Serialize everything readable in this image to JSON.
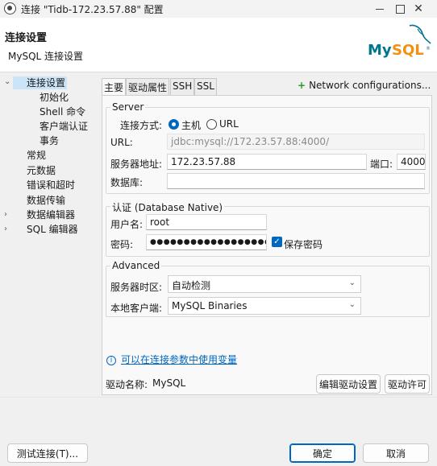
{
  "window": {
    "title": "连接 \"Tidb-172.23.57.88\" 配置",
    "min": "",
    "max": "",
    "close": "✕"
  },
  "header": {
    "title": "连接设置",
    "subtitle": "MySQL 连接设置",
    "logo": "MySQL"
  },
  "nav": {
    "items": [
      {
        "label": "连接设置",
        "selected": true
      },
      {
        "label": "初始化"
      },
      {
        "label": "Shell 命令"
      },
      {
        "label": "客户端认证"
      },
      {
        "label": "事务"
      },
      {
        "label": "常规"
      },
      {
        "label": "元数据"
      },
      {
        "label": "错误和超时"
      },
      {
        "label": "数据传输"
      },
      {
        "label": "数据编辑器"
      },
      {
        "label": "SQL 编辑器"
      }
    ]
  },
  "tabs": [
    {
      "label": "主要",
      "active": true
    },
    {
      "label": "驱动属性"
    },
    {
      "label": "SSH"
    },
    {
      "label": "SSL"
    }
  ],
  "network_config": {
    "label": "Network configurations..."
  },
  "server": {
    "group_title": "Server",
    "connect_mode_label": "连接方式:",
    "mode_host": "主机",
    "mode_url": "URL",
    "url_label": "URL:",
    "url_value": "jdbc:mysql://172.23.57.88:4000/",
    "host_label": "服务器地址:",
    "host_value": "172.23.57.88",
    "port_label": "端口:",
    "port_value": "4000",
    "db_label": "数据库:",
    "db_value": ""
  },
  "auth": {
    "group_title": "认证 (Database Native)",
    "user_label": "用户名:",
    "user_value": "root",
    "password_label": "密码:",
    "password_value": "●●●●●●●●●●●●●●●●●●",
    "save_password_label": "保存密码",
    "save_password_checked": true
  },
  "advanced": {
    "group_title": "Advanced",
    "timezone_label": "服务器时区:",
    "timezone_value": "自动检测",
    "client_label": "本地客户端:",
    "client_value": "MySQL Binaries"
  },
  "vars_link": "可以在连接参数中使用变量",
  "driver": {
    "label": "驱动名称:",
    "value": "MySQL",
    "edit_button": "编辑驱动设置",
    "license_button": "驱动许可"
  },
  "footer": {
    "test_button": "测试连接(T)...",
    "ok_button": "确定",
    "cancel_button": "取消"
  },
  "colors": {
    "accent": "#0067c0",
    "selection": "#cce4f7",
    "mysql_blue": "#00758f",
    "mysql_orange": "#f29111"
  }
}
